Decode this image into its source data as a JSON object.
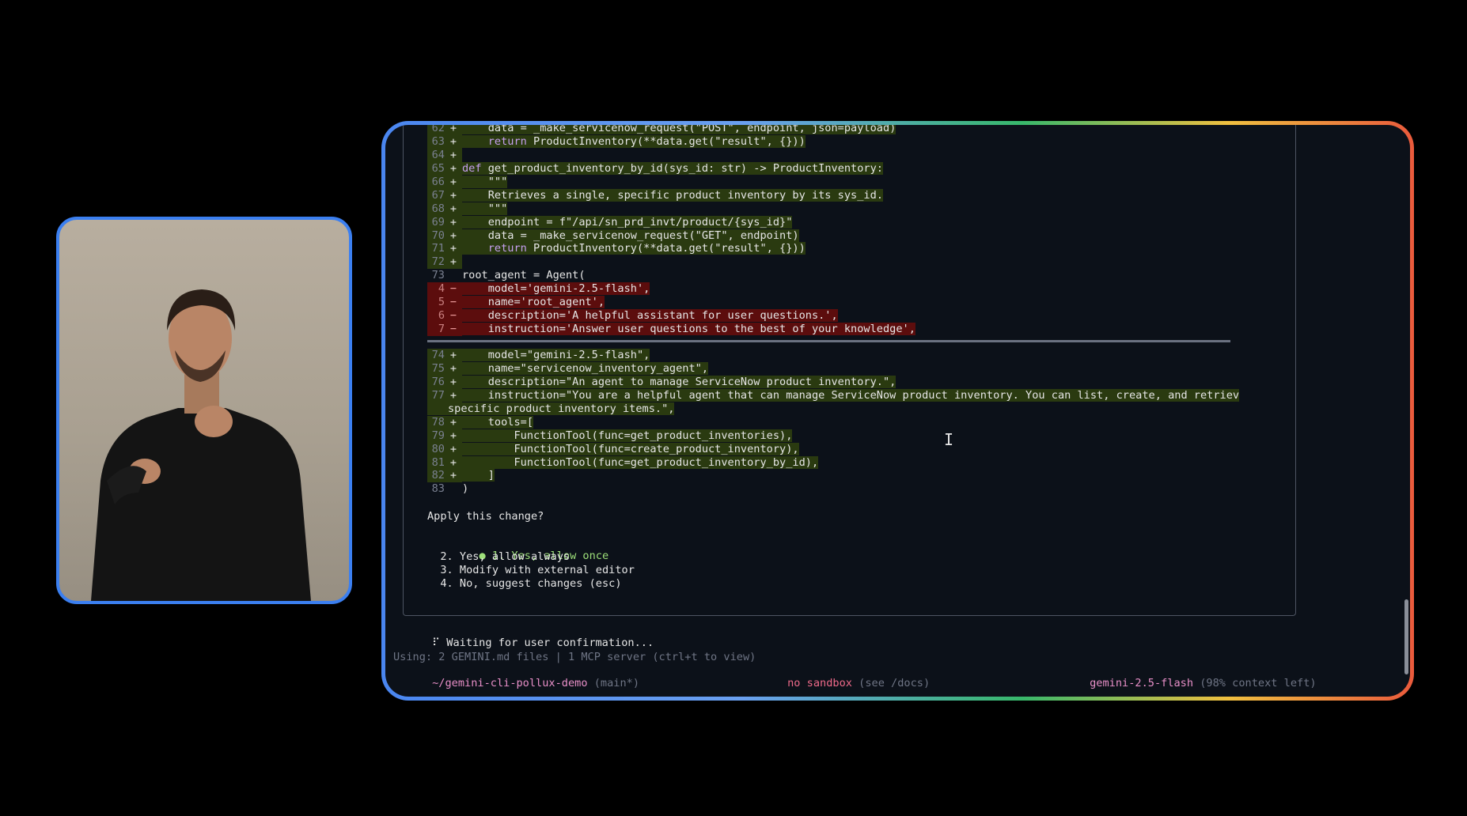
{
  "interpreter": {
    "label": "sign language interpreter"
  },
  "diff_lines": [
    {
      "type": "add",
      "num": "62",
      "text": "    data = _make_servicenow_request(\"POST\", endpoint, json=payload)"
    },
    {
      "type": "add",
      "num": "63",
      "text": "    return ProductInventory(**data.get(\"result\", {}))"
    },
    {
      "type": "add",
      "num": "64",
      "text": ""
    },
    {
      "type": "add",
      "num": "65",
      "text": "def get_product_inventory_by_id(sys_id: str) -> ProductInventory:"
    },
    {
      "type": "add",
      "num": "66",
      "text": "    \"\"\""
    },
    {
      "type": "add",
      "num": "67",
      "text": "    Retrieves a single, specific product inventory by its sys_id."
    },
    {
      "type": "add",
      "num": "68",
      "text": "    \"\"\""
    },
    {
      "type": "add",
      "num": "69",
      "text": "    endpoint = f\"/api/sn_prd_invt/product/{sys_id}\""
    },
    {
      "type": "add",
      "num": "70",
      "text": "    data = _make_servicenow_request(\"GET\", endpoint)"
    },
    {
      "type": "add",
      "num": "71",
      "text": "    return ProductInventory(**data.get(\"result\", {}))"
    },
    {
      "type": "add",
      "num": "72",
      "text": ""
    },
    {
      "type": "ctx",
      "num": "73",
      "text": "root_agent = Agent("
    },
    {
      "type": "del",
      "num": "4",
      "text": "    model='gemini-2.5-flash',"
    },
    {
      "type": "del",
      "num": "5",
      "text": "    name='root_agent',"
    },
    {
      "type": "del",
      "num": "6",
      "text": "    description='A helpful assistant for user questions.',"
    },
    {
      "type": "del",
      "num": "7",
      "text": "    instruction='Answer user questions to the best of your knowledge',"
    }
  ],
  "diff_lines_after": [
    {
      "type": "add",
      "num": "74",
      "text": "    model=\"gemini-2.5-flash\","
    },
    {
      "type": "add",
      "num": "75",
      "text": "    name=\"servicenow_inventory_agent\","
    },
    {
      "type": "add",
      "num": "76",
      "text": "    description=\"An agent to manage ServiceNow product inventory.\","
    },
    {
      "type": "add",
      "num": "77",
      "text": "    instruction=\"You are a helpful agent that can manage ServiceNow product inventory. You can list, create, and retriev"
    },
    {
      "type": "wrap",
      "num": "",
      "text": "specific product inventory items.\","
    },
    {
      "type": "add",
      "num": "78",
      "text": "    tools=["
    },
    {
      "type": "add",
      "num": "79",
      "text": "        FunctionTool(func=get_product_inventories),"
    },
    {
      "type": "add",
      "num": "80",
      "text": "        FunctionTool(func=create_product_inventory),"
    },
    {
      "type": "add",
      "num": "81",
      "text": "        FunctionTool(func=get_product_inventory_by_id),"
    },
    {
      "type": "add",
      "num": "82",
      "text": "    ]"
    },
    {
      "type": "ctx",
      "num": "83",
      "text": ")"
    }
  ],
  "prompt": {
    "question": "Apply this change?",
    "options": [
      "1. Yes, allow once",
      "2. Yes, allow always",
      "3. Modify with external editor",
      "4. No, suggest changes (esc)"
    ],
    "selected_index": 0
  },
  "status": {
    "waiting": "Waiting for user confirmation...",
    "spinner": "⠏",
    "using": "Using: 2 GEMINI.md files | 1 MCP server (ctrl+t to view)",
    "path": "~/gemini-cli-pollux-demo",
    "branch": "(main*)",
    "sandbox": "no sandbox",
    "sandbox_hint": "(see /docs)",
    "model": "gemini-2.5-flash",
    "context": "(98% context left)"
  }
}
